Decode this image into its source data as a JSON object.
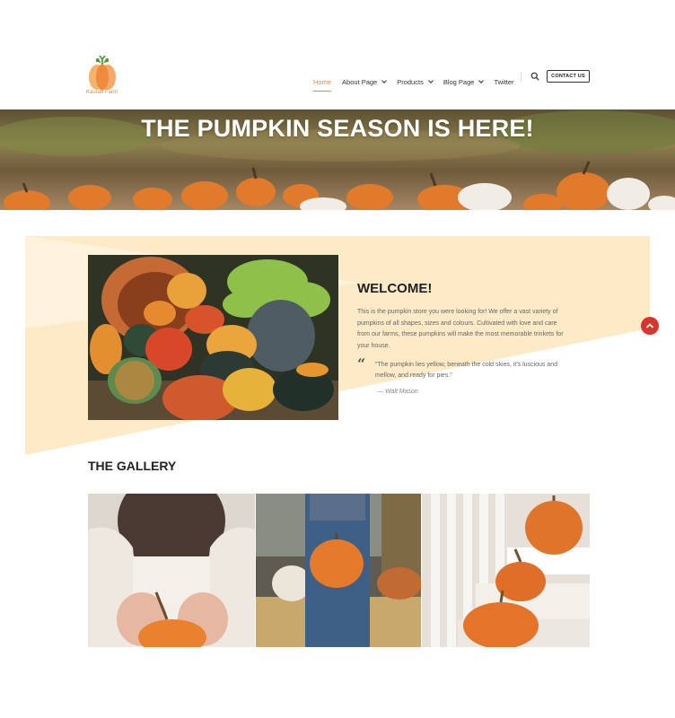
{
  "logo": {
    "text": "Kaurah Farm"
  },
  "nav": {
    "items": [
      {
        "label": "Home",
        "active": true,
        "dropdown": false
      },
      {
        "label": "About Page",
        "active": false,
        "dropdown": true
      },
      {
        "label": "Products",
        "active": false,
        "dropdown": true
      },
      {
        "label": "Blog Page",
        "active": false,
        "dropdown": true
      },
      {
        "label": "Twitter",
        "active": false,
        "dropdown": false
      }
    ],
    "contact_label": "CONTACT US"
  },
  "hero": {
    "title": "THE PUMPKIN SEASON IS HERE!"
  },
  "welcome": {
    "title": "WELCOME!",
    "text": "This is the pumpkin store you were looking for! We offer a vast variety of pumpkins of all shapes, sizes and colours. Cultivated with love and care from our farms, these pumpkins will make the most memorable trinkets for your house.",
    "quote": "\"The pumpkin lies yellow, beneath the cold skies, it's luscious and mellow, and ready for pies.\"",
    "quote_author": "— Walt Mason"
  },
  "gallery": {
    "title": "THE GALLERY"
  },
  "colors": {
    "accent": "#e38a3a",
    "scroll_button": "#d9342e",
    "band": "#fdebc8"
  }
}
